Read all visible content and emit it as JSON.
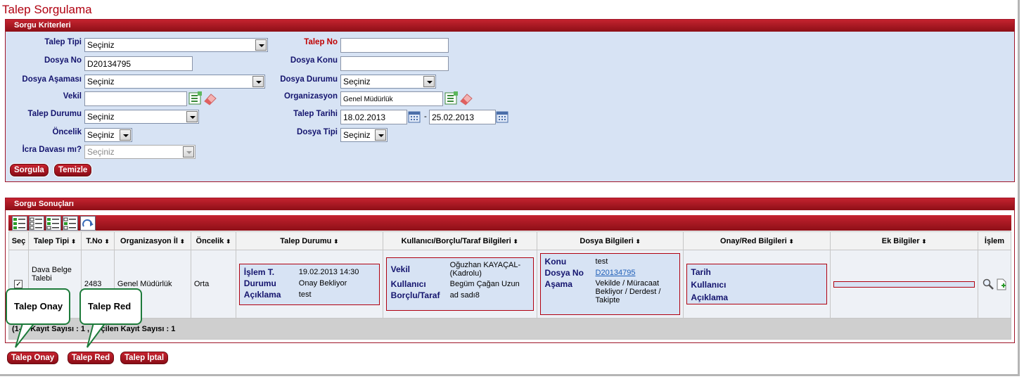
{
  "page_title": "Talep Sorgulama",
  "criteria": {
    "header": "Sorgu Kriterleri",
    "talep_tipi": {
      "label": "Talep Tipi",
      "value": "Seçiniz"
    },
    "talep_no": {
      "label": "Talep No",
      "value": ""
    },
    "dosya_no": {
      "label": "Dosya No",
      "value": "D20134795"
    },
    "dosya_konu": {
      "label": "Dosya Konu",
      "value": ""
    },
    "dosya_asamasi": {
      "label": "Dosya Aşaması",
      "value": "Seçiniz"
    },
    "dosya_durumu": {
      "label": "Dosya Durumu",
      "value": "Seçiniz"
    },
    "vekil": {
      "label": "Vekil",
      "value": ""
    },
    "organizasyon": {
      "label": "Organizasyon",
      "value": "Genel Müdürlük"
    },
    "talep_durumu": {
      "label": "Talep Durumu",
      "value": "Seçiniz"
    },
    "talep_tarihi": {
      "label": "Talep Tarihi",
      "from": "18.02.2013",
      "sep": "-",
      "to": "25.02.2013"
    },
    "oncelik": {
      "label": "Öncelik",
      "value": "Seçiniz"
    },
    "dosya_tipi": {
      "label": "Dosya Tipi",
      "value": "Seçiniz"
    },
    "icra_davasi": {
      "label": "İcra Davası mı?",
      "value": "Seçiniz"
    },
    "btn_sorgula": "Sorgula",
    "btn_temizle": "Temizle"
  },
  "results": {
    "header": "Sorgu Sonuçları",
    "columns": [
      "Seç",
      "Talep Tipi",
      "T.No",
      "Organizasyon İl",
      "Öncelik",
      "Talep Durumu",
      "Kullanıcı/Borçlu/Taraf Bilgileri",
      "Dosya Bilgileri",
      "Onay/Red Bilgileri",
      "Ek Bilgiler",
      "İşlem"
    ],
    "sort_arrow": "⬍",
    "row": {
      "talep_tipi": "Dava Belge Talebi",
      "tno": "2483",
      "organizasyon": "Genel Müdürlük",
      "oncelik": "Orta",
      "durum": {
        "islem_t_label": "İşlem T.",
        "islem_t": "19.02.2013 14:30",
        "durumu_label": "Durumu",
        "durumu": "Onay Bekliyor",
        "aciklama_label": "Açıklama",
        "aciklama": "test"
      },
      "kullanici": {
        "vekil_label": "Vekil",
        "vekil": "Oğuzhan KAYAÇAL-(Kadrolu)",
        "kullanici_label": "Kullanıcı",
        "kullanici": "Begüm Çağan Uzun",
        "borclu_label": "Borçlu/Taraf",
        "borclu": "ad sadı8"
      },
      "dosya": {
        "konu_label": "Konu",
        "konu": "test",
        "dosya_no_label": "Dosya No",
        "dosya_no": "D20134795",
        "asama_label": "Aşama",
        "asama": "Vekilde / Müracaat Bekliyor / Derdest / Takipte"
      },
      "onay": {
        "tarih_label": "Tarih",
        "kullanici_label": "Kullanıcı",
        "aciklama_label": "Açıklama"
      }
    },
    "footer": "(1-1) Kayıt Sayısı : 1 , Seçilen Kayıt Sayısı : 1"
  },
  "actions": {
    "onay": "Talep Onay",
    "red": "Talep Red",
    "iptal": "Talep İptal"
  },
  "callouts": {
    "onay": "Talep Onay",
    "red": "Talep Red"
  }
}
